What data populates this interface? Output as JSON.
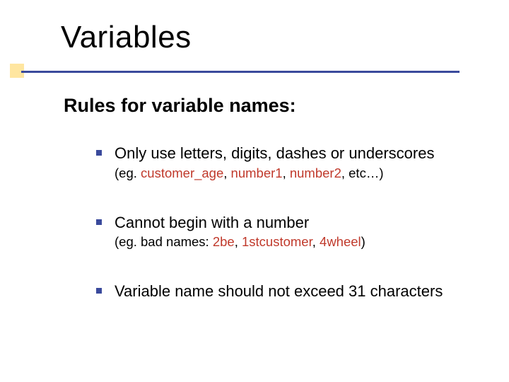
{
  "title": "Variables",
  "subtitle": "Rules for variable names:",
  "rules": [
    {
      "text": "Only use letters, digits, dashes or underscores",
      "eg_prefix": "(eg. ",
      "examples": [
        "customer_age",
        "number1",
        "number2"
      ],
      "eg_suffix": ", etc…)"
    },
    {
      "text": "Cannot begin with a number",
      "eg_prefix": "(eg. bad names: ",
      "examples": [
        "2be",
        "1stcustomer",
        "4wheel"
      ],
      "eg_suffix": ")"
    },
    {
      "text": "Variable name should not exceed 31 characters"
    }
  ]
}
